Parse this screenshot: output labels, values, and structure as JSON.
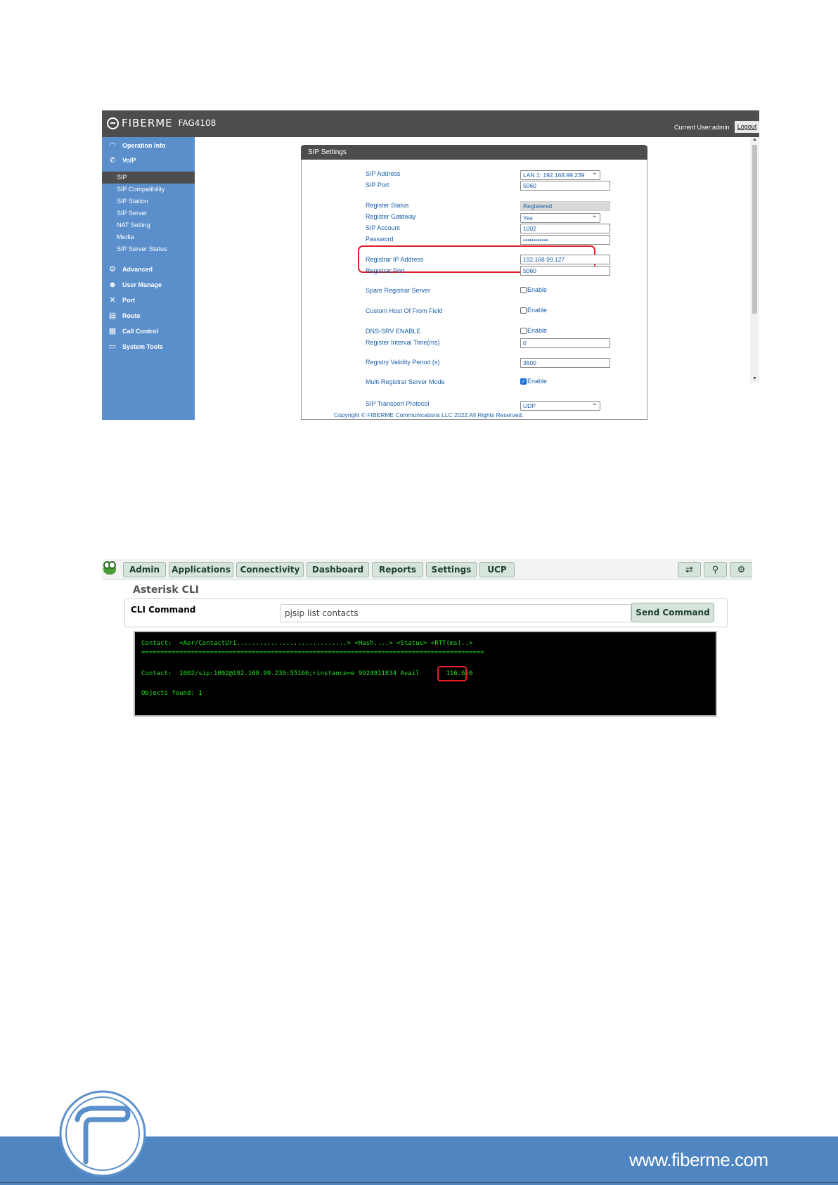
{
  "gateway": {
    "brand": "FIBERME",
    "model": "FAG4108",
    "current_user": "Current User:admin",
    "logout": "Logout",
    "nav": [
      {
        "label": "Operation Info",
        "icon": "gauge-icon"
      },
      {
        "label": "VoIP",
        "icon": "phone-icon"
      },
      {
        "label": "Advanced",
        "icon": "gear-icon"
      },
      {
        "label": "User Manage",
        "icon": "users-icon"
      },
      {
        "label": "Port",
        "icon": "tools-icon"
      },
      {
        "label": "Route",
        "icon": "route-icon"
      },
      {
        "label": "Call Control",
        "icon": "grid-icon"
      },
      {
        "label": "System Tools",
        "icon": "system-tools-icon"
      }
    ],
    "voip_sub": [
      "SIP",
      "SIP Compatibility",
      "SIP Station",
      "SIP Server",
      "NAT Setting",
      "Media",
      "SIP Server Status"
    ],
    "active_sub": "SIP",
    "panel_title": "SIP Settings",
    "fields": {
      "sip_address": {
        "label": "SIP Address",
        "value": "LAN 1: 192.168.99.239"
      },
      "sip_port": {
        "label": "SIP Port",
        "value": "5060"
      },
      "register_status": {
        "label": "Register Status",
        "value": "Registered"
      },
      "register_gateway": {
        "label": "Register Gateway",
        "value": "Yes"
      },
      "sip_account": {
        "label": "SIP Account",
        "value": "1002"
      },
      "password": {
        "label": "Password",
        "value": "••••••••••••"
      },
      "registrar_ip": {
        "label": "Registrar IP Address",
        "value": "192.168.99.127"
      },
      "registrar_port": {
        "label": "Registrar Port",
        "value": "5060"
      },
      "spare_registrar": {
        "label": "Spare Registrar Server",
        "option": "Enable",
        "checked": false
      },
      "custom_host": {
        "label": "Custom Host Of From Field",
        "option": "Enable",
        "checked": false
      },
      "dns_srv": {
        "label": "DNS-SRV ENABLE",
        "option": "Enable",
        "checked": false
      },
      "register_interval": {
        "label": "Register Interval Time(ms)",
        "value": "0"
      },
      "registry_validity": {
        "label": "Registry Validity Period (s)",
        "value": "3600"
      },
      "multi_registrar": {
        "label": "Multi-Registrar Server Mode",
        "option": "Enable",
        "checked": true
      },
      "transport": {
        "label": "SIP Transport Protocol",
        "value": "UDP"
      }
    },
    "copyright": "Copyright © FIBERME Communications LLC 2022.All Rights Reserved."
  },
  "pbx": {
    "menu": [
      "Admin",
      "Applications",
      "Connectivity",
      "Dashboard",
      "Reports",
      "Settings",
      "UCP"
    ],
    "icons": [
      "language-icon",
      "search-icon",
      "gear-icon"
    ],
    "title": "Asterisk CLI",
    "cli_label": "CLI Command",
    "cli_value": "pjsip list contacts",
    "send_button": "Send Command",
    "terminal": {
      "header": "Contact:  <Aor/ContactUri.............................> <Hash....> <Status> <RTT(ms)..>",
      "separator": "==========================================================================================",
      "contact": "Contact:  1002/sip:1002@192.168.99.239:55166;rinstance=e 9924911834 Avail       116.650",
      "objects": "Objects found: 1"
    }
  },
  "footer": {
    "url": "www.fiberme.com"
  },
  "colors": {
    "gateway_sidebar": "#5b8fcb",
    "gateway_topbar": "#4d4d4d",
    "link_blue": "#1a5fa8",
    "highlight_red": "#e0202a",
    "terminal_green": "#22e022",
    "footer_blue": "#4f86c2"
  }
}
